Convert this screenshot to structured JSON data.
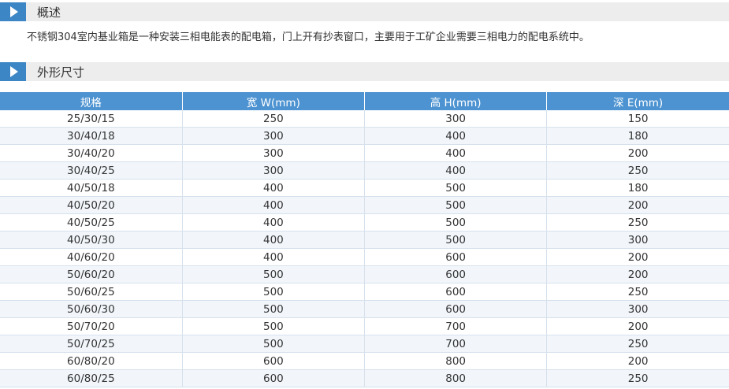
{
  "sections": {
    "overview": {
      "title": "概述"
    },
    "dimensions": {
      "title": "外形尺寸"
    }
  },
  "description": "不锈钢304室内基业箱是一种安装三相电能表的配电箱，门上开有抄表窗口，主要用于工矿企业需要三相电力的配电系统中。",
  "table": {
    "headers": [
      "规格",
      "宽 W(mm)",
      "高 H(mm)",
      "深 E(mm)"
    ],
    "rows": [
      [
        "25/30/15",
        "250",
        "300",
        "150"
      ],
      [
        "30/40/18",
        "300",
        "400",
        "180"
      ],
      [
        "30/40/20",
        "300",
        "400",
        "200"
      ],
      [
        "30/40/25",
        "300",
        "400",
        "250"
      ],
      [
        "40/50/18",
        "400",
        "500",
        "180"
      ],
      [
        "40/50/20",
        "400",
        "500",
        "200"
      ],
      [
        "40/50/25",
        "400",
        "500",
        "250"
      ],
      [
        "40/50/30",
        "400",
        "500",
        "300"
      ],
      [
        "40/60/20",
        "400",
        "600",
        "200"
      ],
      [
        "50/60/20",
        "500",
        "600",
        "200"
      ],
      [
        "50/60/25",
        "500",
        "600",
        "250"
      ],
      [
        "50/60/30",
        "500",
        "600",
        "300"
      ],
      [
        "50/70/20",
        "500",
        "700",
        "200"
      ],
      [
        "50/70/25",
        "500",
        "700",
        "250"
      ],
      [
        "60/80/20",
        "600",
        "800",
        "200"
      ],
      [
        "60/80/25",
        "600",
        "800",
        "250"
      ]
    ]
  },
  "colors": {
    "accent": "#3d86c6",
    "table_header": "#4d93d1",
    "section_bg": "#ededed",
    "row_alt": "#f2f6fb"
  },
  "icons": {
    "section_marker": "play-triangle-icon"
  }
}
